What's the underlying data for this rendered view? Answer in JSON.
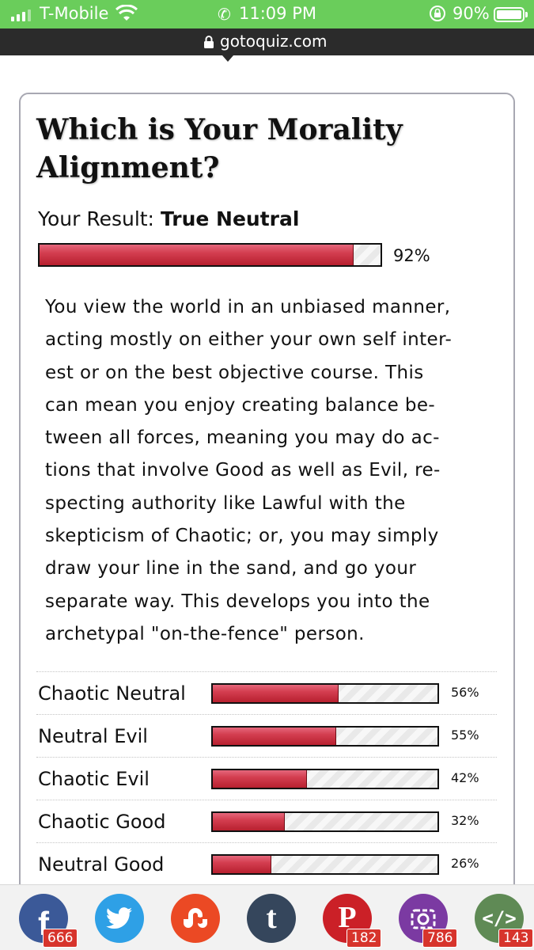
{
  "status": {
    "carrier": "T-Mobile",
    "time": "11:09 PM",
    "battery": "90%",
    "battery_level": 0.9
  },
  "browser": {
    "url": "gotoquiz.com"
  },
  "quiz": {
    "title_line1": "Which is Your Morality",
    "title_line2": "Alignment?",
    "result_label": "Your Result:",
    "result_value": "True Neutral",
    "result_percent": "92%",
    "result_level": 92,
    "description_lines": [
      "You view the world in an unbiased manner,",
      "acting mostly on either your own self inter-",
      "est or on the best objective course. This",
      "can mean you enjoy creating balance be-",
      "tween all forces, meaning you may do ac-",
      "tions that involve Good as well as Evil, re-",
      "specting authority like Lawful with the",
      "skepticism of Chaotic; or, you may simply",
      "draw your line in the sand, and go your",
      "separate way. This develops you into the",
      "archetypal \"on-the-fence\" person."
    ],
    "other_results": [
      {
        "name": "Chaotic Neutral",
        "percent": "56%",
        "level": 56
      },
      {
        "name": "Neutral Evil",
        "percent": "55%",
        "level": 55
      },
      {
        "name": "Chaotic Evil",
        "percent": "42%",
        "level": 42
      },
      {
        "name": "Chaotic Good",
        "percent": "32%",
        "level": 32
      },
      {
        "name": "Neutral Good",
        "percent": "26%",
        "level": 26
      }
    ]
  },
  "share": [
    {
      "name": "facebook",
      "icon": "facebook-icon",
      "glyph": "f",
      "color": "#3b5998",
      "count": "666"
    },
    {
      "name": "twitter",
      "icon": "twitter-icon",
      "glyph": "",
      "color": "#2ea0e6",
      "count": ""
    },
    {
      "name": "stumbleupon",
      "icon": "stumbleupon-icon",
      "glyph": "",
      "color": "#eb4924",
      "count": ""
    },
    {
      "name": "tumblr",
      "icon": "tumblr-icon",
      "glyph": "t",
      "color": "#35465c",
      "count": ""
    },
    {
      "name": "pinterest",
      "icon": "pinterest-icon",
      "glyph": "P",
      "color": "#cb2027",
      "count": "182"
    },
    {
      "name": "instagram",
      "icon": "camera-icon",
      "glyph": "",
      "color": "#7b3aa2",
      "count": "786"
    },
    {
      "name": "embed",
      "icon": "code-icon",
      "glyph": "</>",
      "color": "#5f8a55",
      "count": "143"
    }
  ]
}
